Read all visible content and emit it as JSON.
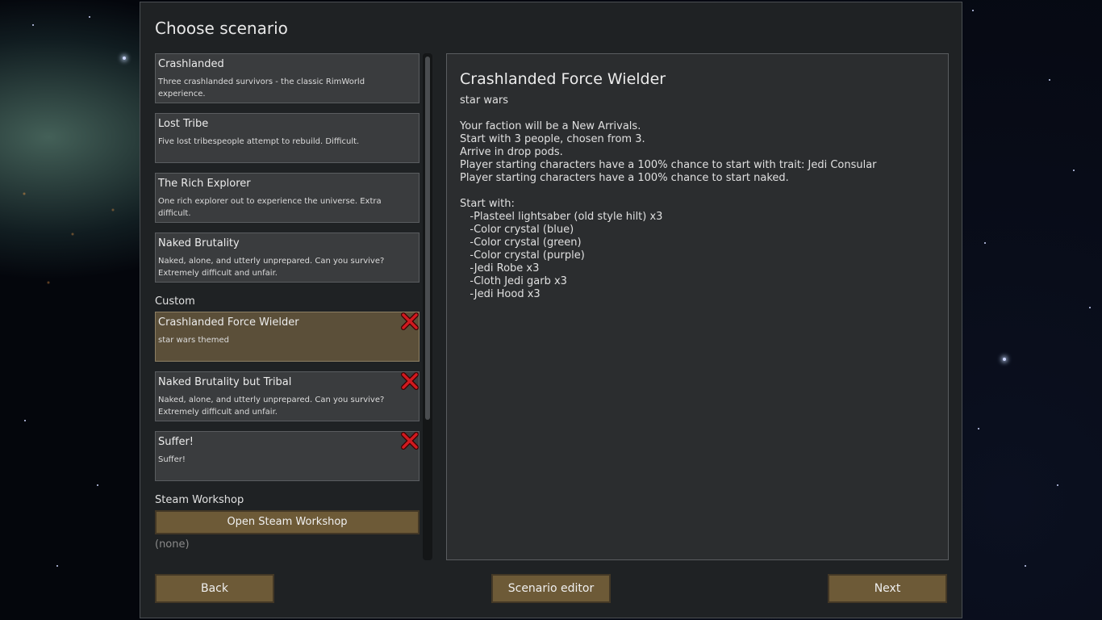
{
  "window": {
    "title": "Choose scenario"
  },
  "scenarios": {
    "builtin": [
      {
        "name": "Crashlanded",
        "description": "Three crashlanded survivors - the classic RimWorld experience."
      },
      {
        "name": "Lost Tribe",
        "description": "Five lost tribespeople attempt to rebuild. Difficult."
      },
      {
        "name": "The Rich Explorer",
        "description": "One rich explorer out to experience the universe. Extra difficult."
      },
      {
        "name": "Naked Brutality",
        "description": "Naked, alone, and utterly unprepared. Can you survive? Extremely difficult and unfair."
      }
    ],
    "custom_label": "Custom",
    "custom": [
      {
        "name": "Crashlanded Force Wielder",
        "description": "star wars themed",
        "selected": true
      },
      {
        "name": "Naked Brutality but Tribal",
        "description": "Naked, alone, and utterly unprepared. Can you survive? Extremely difficult and unfair.",
        "selected": false
      },
      {
        "name": "Suffer!",
        "description": "Suffer!",
        "selected": false
      }
    ],
    "workshop_label": "Steam Workshop",
    "workshop_button": "Open Steam Workshop",
    "workshop_empty": "(none)"
  },
  "detail": {
    "title": "Crashlanded Force Wielder",
    "subtitle": "star wars",
    "lines": [
      "Your faction will be a New Arrivals.",
      "Start with 3 people, chosen from 3.",
      "Arrive in drop pods.",
      "Player starting characters have a 100% chance to start with trait: Jedi Consular",
      "Player starting characters have a 100% chance to start naked.",
      "",
      "Start with:",
      "   -Plasteel lightsaber (old style hilt) x3",
      "   -Color crystal (blue)",
      "   -Color crystal (green)",
      "   -Color crystal (purple)",
      "   -Jedi Robe x3",
      "   -Cloth Jedi garb x3",
      "   -Jedi Hood x3"
    ]
  },
  "buttons": {
    "back": "Back",
    "editor": "Scenario editor",
    "next": "Next"
  },
  "icons": {
    "delete": "delete-x-icon"
  },
  "colors": {
    "panel": "#1f2224",
    "card": "#3a3c3e",
    "card_selected": "#5b4f39",
    "button": "#6d5a37",
    "delete_red": "#c8181c"
  }
}
